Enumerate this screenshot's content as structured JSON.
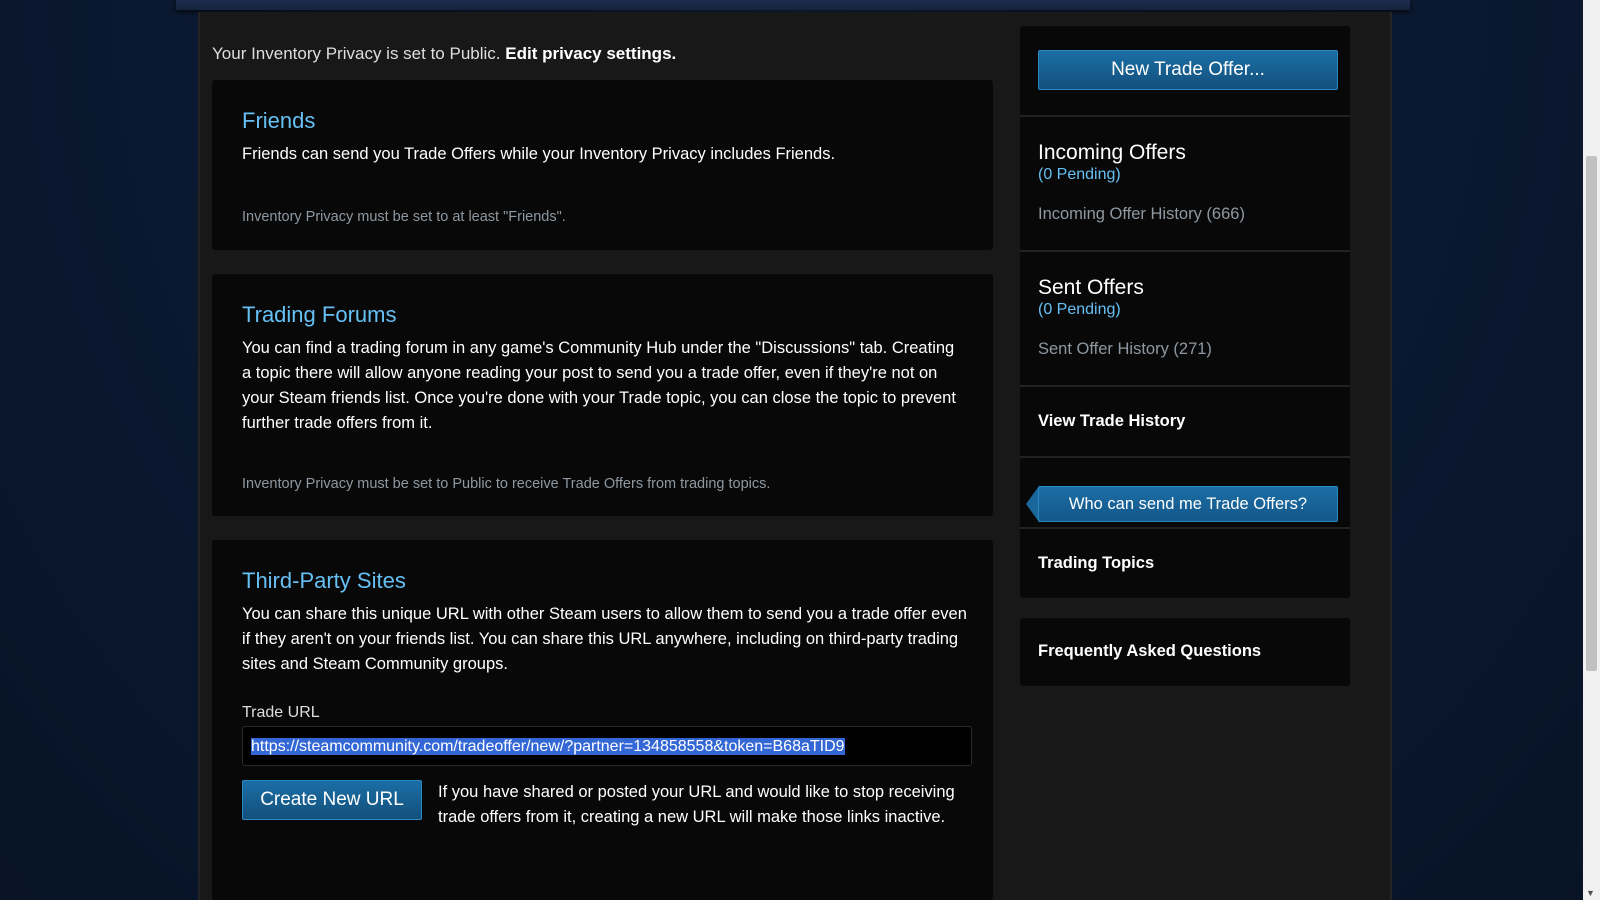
{
  "privacy": {
    "text": "Your Inventory Privacy is set to Public.",
    "link": "Edit privacy settings."
  },
  "friends": {
    "title": "Friends",
    "description": "Friends can send you Trade Offers while your Inventory Privacy includes Friends.",
    "note": "Inventory Privacy must be set to at least \"Friends\"."
  },
  "forums": {
    "title": "Trading Forums",
    "description": "You can find a trading forum in any game's Community Hub under the \"Discussions\" tab. Creating a topic there will allow anyone reading your post to send you a trade offer, even if they're not on your Steam friends list. Once you're done with your Trade topic, you can close the topic to prevent further trade offers from it.",
    "note": "Inventory Privacy must be set to Public to receive Trade Offers from trading topics."
  },
  "third_party": {
    "title": "Third-Party Sites",
    "description": "You can share this unique URL with other Steam users to allow them to send you a trade offer even if they aren't on your friends list. You can share this URL anywhere, including on third-party trading sites and Steam Community groups.",
    "trade_url_label": "Trade URL",
    "trade_url_value": "https://steamcommunity.com/tradeoffer/new/?partner=134858558&token=B68aTID9",
    "create_button": "Create New URL",
    "create_description": "If you have shared or posted your URL and would like to stop receiving trade offers from it, creating a new URL will make those links inactive."
  },
  "sidebar": {
    "new_offer_button": "New Trade Offer...",
    "incoming": {
      "heading": "Incoming Offers",
      "pending": "(0 Pending)",
      "history": "Incoming Offer History (666)"
    },
    "sent": {
      "heading": "Sent Offers",
      "pending": "(0 Pending)",
      "history": "Sent Offer History (271)"
    },
    "view_history": "View Trade History",
    "who_can_send": "Who can send me Trade Offers?",
    "trading_topics": "Trading Topics",
    "faq": "Frequently Asked Questions"
  }
}
